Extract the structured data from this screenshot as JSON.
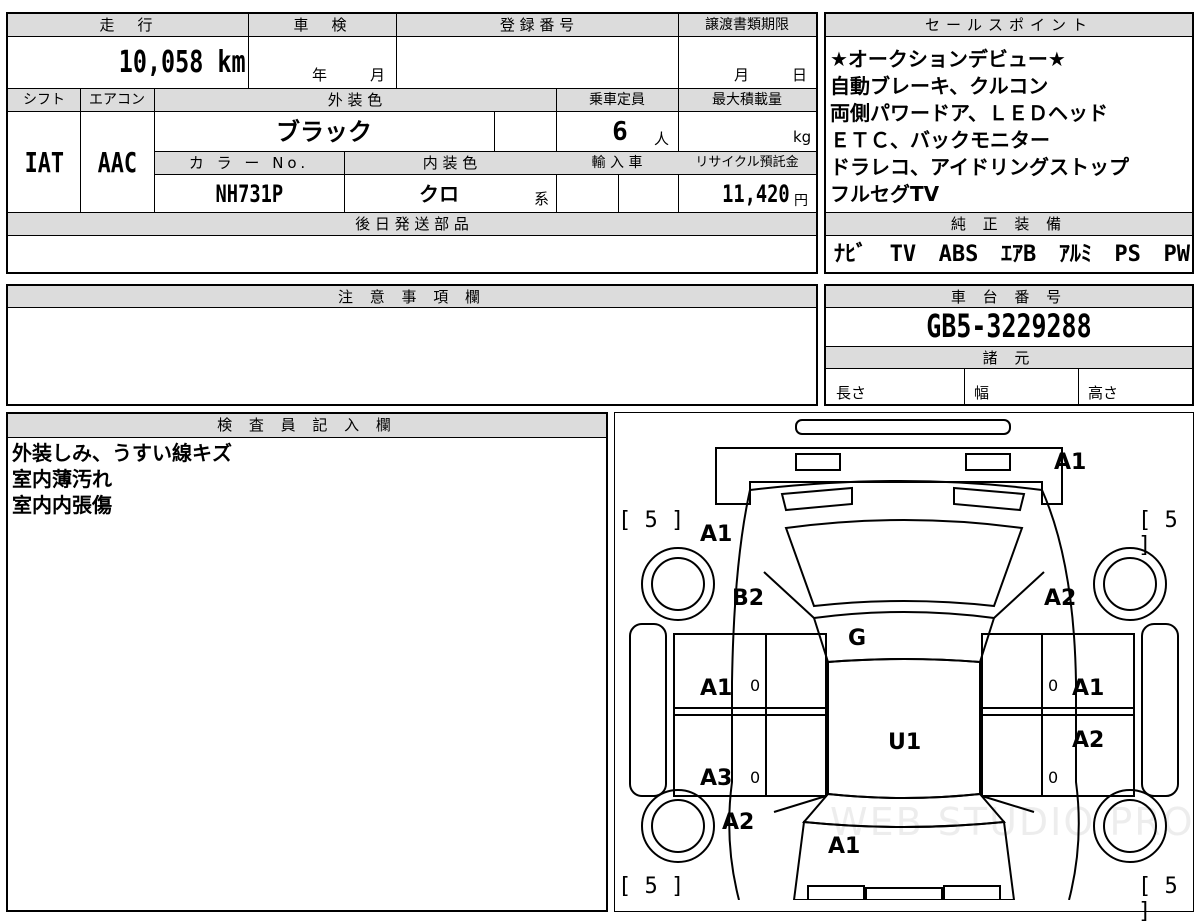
{
  "top": {
    "mileage_header": "走　行",
    "mileage_value": "10,058 km",
    "shaken_header": "車　検",
    "shaken_year": "年",
    "shaken_month": "月",
    "reg_header": "登 録 番 号",
    "transfer_header": "譲渡書類期限",
    "transfer_month": "月",
    "transfer_day": "日"
  },
  "spec": {
    "shift_header": "シフト",
    "shift_value": "IAT",
    "ac_header": "エアコン",
    "ac_value": "AAC",
    "ext_color_header": "外 装 色",
    "ext_color_value": "ブラック",
    "capacity_header": "乗車定員",
    "capacity_value": "6",
    "capacity_unit": "人",
    "maxload_header": "最大積載量",
    "maxload_unit": "kg",
    "colorno_header": "カ ラ ー No.",
    "colorno_value": "NH731P",
    "int_color_header": "内 装 色",
    "int_color_value": "クロ",
    "int_color_suffix": "系",
    "import_header": "輸 入 車",
    "recycle_header": "リサイクル預託金",
    "recycle_value": "11,420",
    "recycle_unit": "円"
  },
  "later_parts_header": "後 日 発 送 部 品",
  "notes_header": "注 意 事 項 欄",
  "sales": {
    "header": "セールスポイント",
    "lines": [
      "★オークションデビュー★",
      "自動ブレーキ、クルコン",
      "両側パワードア、ＬＥＤヘッド",
      "ＥＴＣ、バックモニター",
      "ドラレコ、アイドリングストップ",
      "フルセグTV"
    ]
  },
  "equipment": {
    "header": "純 正 装 備",
    "items": [
      "ﾅﾋﾞ",
      "TV",
      "ABS",
      "ｴｱB",
      "ｱﾙﾐ",
      "PS",
      "PW"
    ]
  },
  "chassis": {
    "header": "車 台 番 号",
    "value": "GB5-3229288",
    "specs_header": "諸 元",
    "length_label": "長さ",
    "width_label": "幅",
    "height_label": "高さ"
  },
  "inspector": {
    "header": "検 査 員 記 入 欄",
    "lines": [
      "外装しみ、うすい線キズ",
      "室内薄汚れ",
      "室内内張傷"
    ]
  },
  "diagram": {
    "tire_fl": "5",
    "tire_fr": "5",
    "tire_rl": "5",
    "tire_rr": "5",
    "marks": {
      "front_bumper": "A1",
      "fender_left": "A1",
      "pillar_left": "B2",
      "fender_right": "A2",
      "hood": "G",
      "door_fl": "A1",
      "door_fr": "A1",
      "roof": "U1",
      "door_rl": "A3",
      "door_rr": "A2",
      "quarter_left": "A2",
      "tailgate": "A1"
    },
    "door_zero_a": "0",
    "door_zero_b": "0",
    "door_zero_c": "0",
    "door_zero_d": "0",
    "watermark": "WEB STUDIO PRO"
  }
}
